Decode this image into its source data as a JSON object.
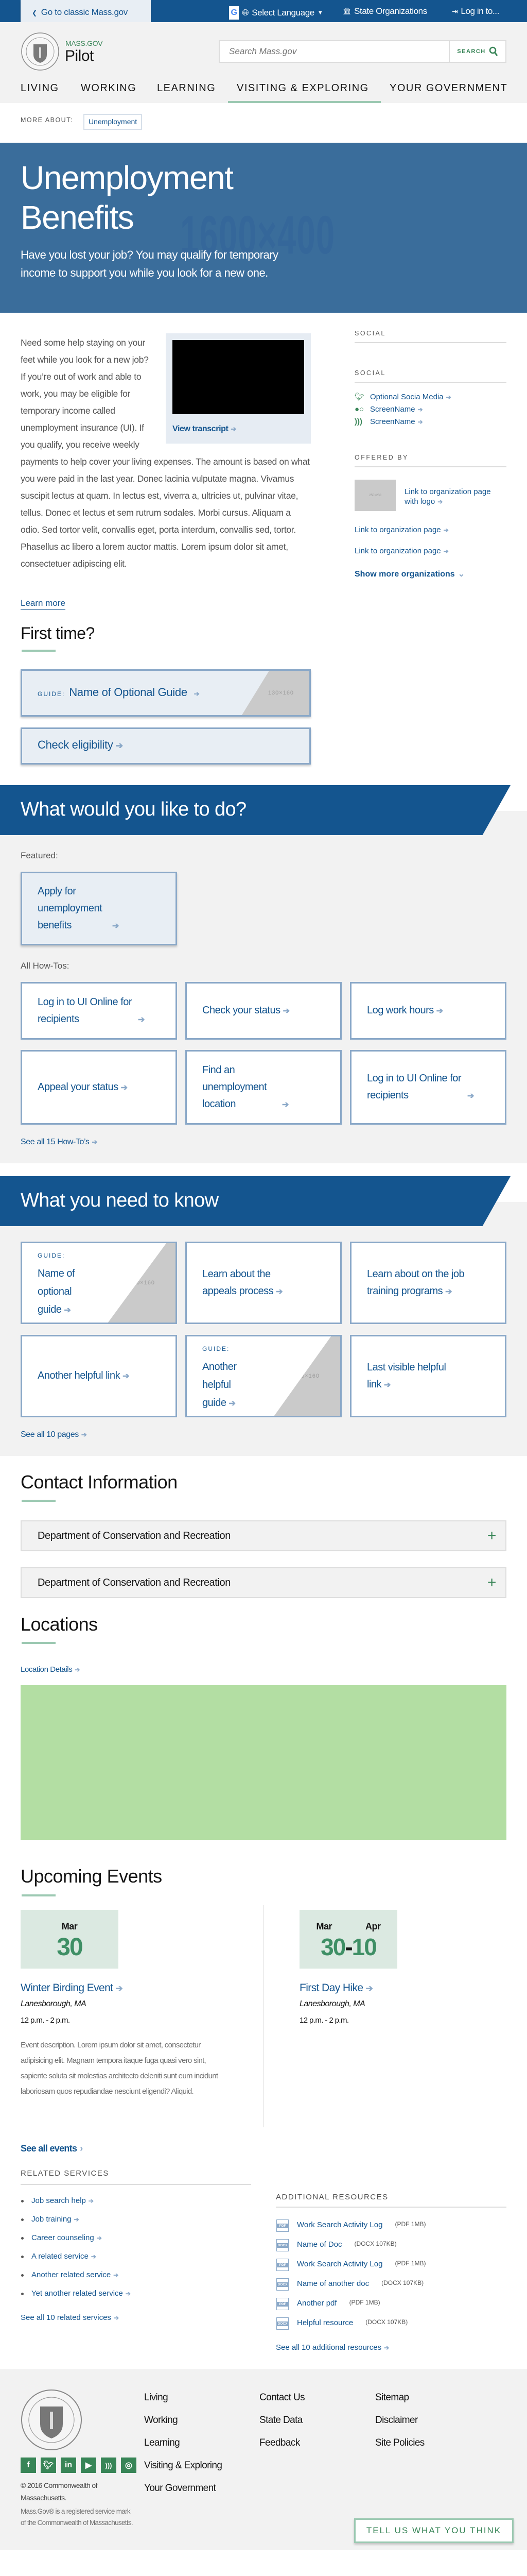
{
  "topbar": {
    "classic_link": "Go to classic Mass.gov",
    "select_language": "Select Language",
    "state_orgs": "State Organizations",
    "login": "Log in to..."
  },
  "header": {
    "brand_small": "MASS.GOV",
    "brand_big": "Pilot",
    "search_placeholder": "Search Mass.gov",
    "search_button": "SEARCH",
    "nav": [
      "LIVING",
      "WORKING",
      "LEARNING",
      "VISITING & EXPLORING",
      "YOUR GOVERNMENT"
    ],
    "active_nav": "VISITING & EXPLORING"
  },
  "more_about": {
    "label": "MORE ABOUT:",
    "tag": "Unemployment"
  },
  "hero": {
    "title_line1": "Unemployment",
    "title_line2": "Benefits",
    "placeholder": "1600×400",
    "subtitle": "Have you lost your job? You may qualify for temporary income to support you while you look for a new one."
  },
  "intro": {
    "body": "Need some help staying on your feet while you look for a new job? If you’re out of work and able to work, you may be eligible for temporary income called unemployment insurance (UI). If you qualify, you receive weekly payments to help cover your living expenses. The amount is based on what you were paid in the last year. Donec lacinia vulputate magna. Vivamus suscipit lectus at quam. In lectus est, viverra a, ultricies ut, pulvinar vitae, tellus. Donec et lectus et sem rutrum sodales. Morbi cursus. Aliquam a odio. Sed tortor velit, convallis eget, porta interdum, convallis sed, tortor. Phasellus ac libero a lorem auctor mattis. Lorem ipsum dolor sit amet, consectetuer adipiscing elit.",
    "video_link": "View transcript",
    "learn_more": "Learn more"
  },
  "first_time": {
    "heading": "First time?",
    "guide_label": "GUIDE:",
    "guide_title": "Name of Optional Guide",
    "guide_image": "130×160",
    "check": "Check eligibility"
  },
  "sidebar": {
    "social_heading_1": "SOCIAL",
    "social_heading_2": "SOCIAL",
    "social_links": [
      {
        "icon": "twitter-icon",
        "label": "Optional Socia Media"
      },
      {
        "icon": "flickr-icon",
        "label": "ScreenName"
      },
      {
        "icon": "rss-icon",
        "label": "ScreenName"
      }
    ],
    "offered_by": "OFFERED BY",
    "logo_placeholder": "250×250",
    "org_logo_link": "Link to organization page with logo",
    "org_links": [
      "Link to organization page",
      "Link to organization page"
    ],
    "show_more": "Show more organizations"
  },
  "what_to_do": {
    "heading": "What would you like to do?",
    "featured_label": "Featured:",
    "featured": "Apply for unemployment benefits",
    "all_label": "All How-Tos:",
    "howtos": [
      "Log in to UI Online for recipients",
      "Check your status",
      "Log work hours",
      "Appeal your status",
      "Find an unemployment location",
      "Log in to UI Online for recipients"
    ],
    "see_all": "See all 15 How-To’s"
  },
  "need_to_know": {
    "heading": "What you need to know",
    "guide_label": "GUIDE:",
    "image": "130×160",
    "cards": [
      "Name of optional guide",
      "Learn about the appeals process",
      "Learn about on the job training programs",
      "Another helpful link",
      "Another helpful guide",
      "Last visible helpful link"
    ],
    "see_all": "See all 10 pages"
  },
  "contact": {
    "heading": "Contact Information",
    "items": [
      "Department of Conservation and Recreation",
      "Department of Conservation and Recreation"
    ]
  },
  "locations": {
    "heading": "Locations",
    "details": "Location Details",
    "map_color": "#b3dea3"
  },
  "events": {
    "heading": "Upcoming Events",
    "items": [
      {
        "month": "Mar",
        "day": "30",
        "title": "Winter Birding Event",
        "location": "Lanesborough, MA",
        "time": "12 p.m. - 2 p.m.",
        "description": "Event description. Lorem ipsum dolor sit amet, consectetur adipisicing elit. Magnam tempora itaque fuga quasi vero sint, sapiente soluta sit molestias architecto deleniti sunt eum incidunt laboriosam quos repudiandae nesciunt eligendi? Aliquid."
      },
      {
        "month_start": "Mar",
        "month_end": "Apr",
        "day_start": "30",
        "day_end": "10",
        "title": "First Day Hike",
        "location": "Lanesborough, MA",
        "time": "12 p.m. - 2 p.m."
      }
    ],
    "see_all": "See all events"
  },
  "related_services": {
    "heading": "RELATED SERVICES",
    "items": [
      "Job search help",
      "Job training",
      "Career counseling",
      "A related service",
      "Another related service",
      "Yet another related service"
    ],
    "see_all": "See all 10 related services"
  },
  "additional_resources": {
    "heading": "ADDITIONAL RESOURCES",
    "items": [
      {
        "type": "PDF",
        "title": "Work Search Activity Log",
        "size": "(PDF 1MB)"
      },
      {
        "type": "DOCX",
        "title": "Name of Doc",
        "size": "(DOCX 107KB)"
      },
      {
        "type": "PDF",
        "title": "Work Search Activity Log",
        "size": "(PDF 1MB)"
      },
      {
        "type": "DOCX",
        "title": "Name of another doc",
        "size": "(DOCX 107KB)"
      },
      {
        "type": "PDF",
        "title": "Another pdf",
        "size": "(PDF 1MB)"
      },
      {
        "type": "DOCX",
        "title": "Helpful resource",
        "size": "(DOCX 107KB)"
      }
    ],
    "see_all": "See all 10 additional resources"
  },
  "footer": {
    "col1": [
      "Living",
      "Working",
      "Learning",
      "Visiting & Exploring",
      "Your Government"
    ],
    "col2": [
      "Contact Us",
      "State Data",
      "Feedback"
    ],
    "col3": [
      "Sitemap",
      "Disclaimer",
      "Site Policies"
    ],
    "social_icons": [
      "facebook-icon",
      "twitter-icon",
      "linkedin-icon",
      "youtube-icon",
      "rss-icon",
      "instagram-icon"
    ],
    "copyright": "© 2016 Commonwealth of Massachusetts.",
    "service_mark": "Mass.Gov® is a registered service mark of the Commonwealth of Massachusetts.",
    "feedback_button": "TELL US WHAT YOU THINK"
  },
  "colors": {
    "brand_blue": "#14558f",
    "hero_blue": "#3a6d9b",
    "green": "#388557",
    "light_green": "#9cc9b2",
    "card_border": "#8aa8c8"
  }
}
